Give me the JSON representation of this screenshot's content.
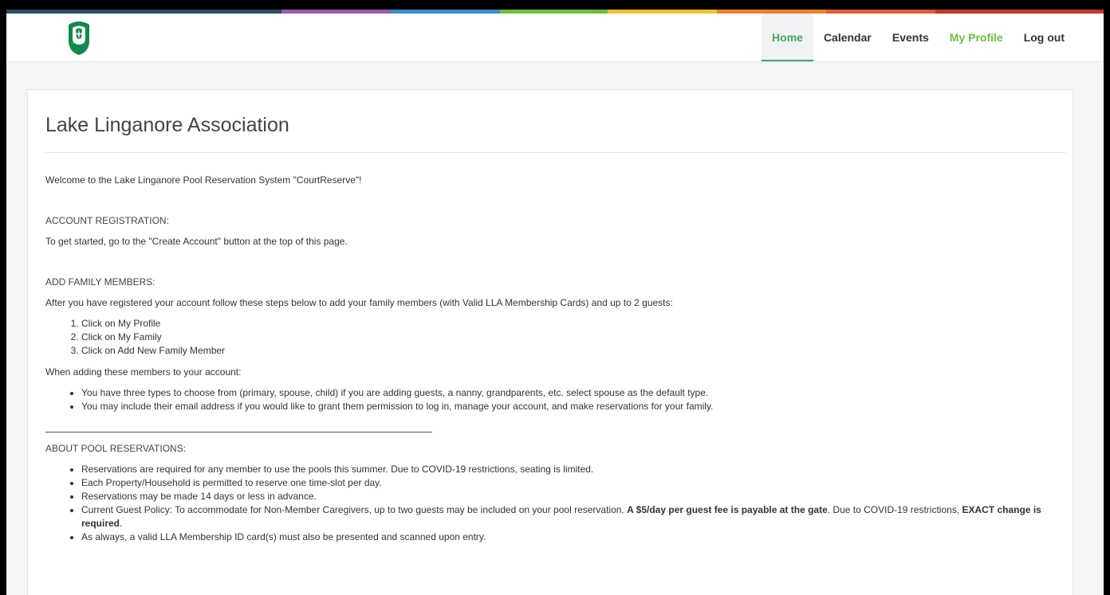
{
  "colors": {
    "accent_green": "#4aa564",
    "bar": [
      "#2e4a62",
      "#9b59b6",
      "#3b8fd0",
      "#6cbd3a",
      "#f2c12e",
      "#e9822c",
      "#e55a3a",
      "#c0392b"
    ]
  },
  "header": {
    "logo_icon": "lake-linganore-logo-icon",
    "nav": [
      {
        "label": "Home"
      },
      {
        "label": "Calendar"
      },
      {
        "label": "Events"
      },
      {
        "label": "My Profile"
      },
      {
        "label": "Log out"
      }
    ]
  },
  "main": {
    "title": "Lake Linganore Association",
    "welcome": "Welcome to the Lake Linganore Pool Reservation System \"CourtReserve\"!",
    "account_registration": {
      "heading": "ACCOUNT REGISTRATION:",
      "text": "To get started, go to the \"Create Account\" button at the top of this page."
    },
    "add_family": {
      "heading": "ADD FAMILY MEMBERS:",
      "intro": "After you have registered your account follow these steps below to add your family members (with Valid LLA Membership Cards) and up to 2 guests:",
      "steps": [
        "Click on My Profile",
        "Click on My Family",
        "Click on Add New Family Member"
      ],
      "when_adding": "When adding these members to your account:",
      "bullets": [
        "You have three types to choose from (primary, spouse, child) if you are adding guests, a nanny, grandparents, etc. select spouse as the default type.",
        "You may include their email address if you would like to grant them permission to log in, manage your account, and make reservations for your family."
      ]
    },
    "pool": {
      "heading": "ABOUT POOL RESERVATIONS:",
      "bullets": [
        "Reservations are required for any member to use the pools this summer. Due to COVID-19 restrictions, seating is limited.",
        "Each Property/Household is permitted to reserve one time-slot per day.",
        "Reservations may be made 14 days or less in advance."
      ],
      "guest_policy": {
        "pre": "Current Guest Policy: To accommodate for Non-Member Caregivers, up to two guests may be included on your pool reservation. ",
        "bold_fee": "A $5/day per guest fee is payable at the gate",
        "mid": ". Due to COVID-19 restrictions, ",
        "bold_exact": "EXACT change is required",
        "post": "."
      },
      "last_bullet": "As always, a valid LLA Membership ID card(s) must also be presented and scanned upon entry."
    }
  }
}
